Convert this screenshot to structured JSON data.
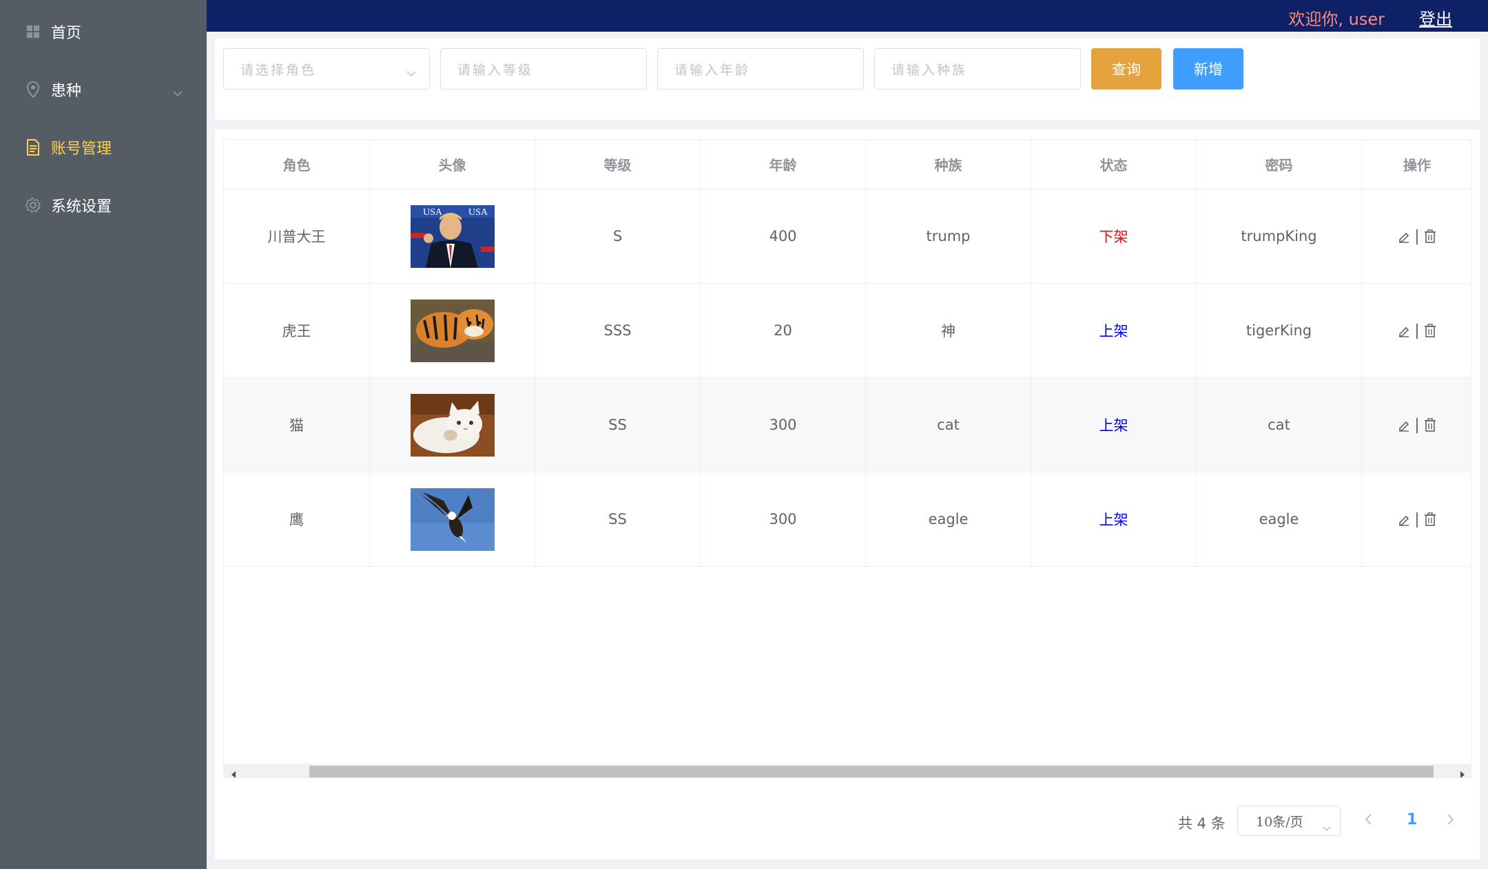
{
  "sidebar": {
    "items": [
      {
        "label": "首页",
        "icon": "grid-icon"
      },
      {
        "label": "患种",
        "icon": "location-icon"
      },
      {
        "label": "账号管理",
        "icon": "document-icon",
        "active": true
      },
      {
        "label": "系统设置",
        "icon": "gear-icon"
      }
    ]
  },
  "header": {
    "welcome": "欢迎你,  user",
    "logout": "登出"
  },
  "filters": {
    "role_placeholder": "请选择角色",
    "level_placeholder": "请输入等级",
    "age_placeholder": "请输入年龄",
    "race_placeholder": "请输入种族",
    "query_label": "查询",
    "add_label": "新增"
  },
  "table": {
    "columns": [
      "角色",
      "头像",
      "等级",
      "年龄",
      "种族",
      "状态",
      "密码",
      "操作"
    ],
    "rows": [
      {
        "role": "川普大王",
        "avatar": "trump-photo",
        "level": "S",
        "age": "400",
        "race": "trump",
        "status": "下架",
        "password": "trumpKing"
      },
      {
        "role": "虎王",
        "avatar": "tiger-photo",
        "level": "SSS",
        "age": "20",
        "race": "神",
        "status": "上架",
        "password": "tigerKing"
      },
      {
        "role": "猫",
        "avatar": "cat-photo",
        "level": "SS",
        "age": "300",
        "race": "cat",
        "status": "上架",
        "password": "cat"
      },
      {
        "role": "鹰",
        "avatar": "eagle-photo",
        "level": "SS",
        "age": "300",
        "race": "eagle",
        "status": "上架",
        "password": "eagle"
      }
    ],
    "op_separator": "|"
  },
  "pagination": {
    "total": "共 4 条",
    "page_size": "10条/页",
    "current_page": "1"
  },
  "colors": {
    "sidebar_bg": "#545c64",
    "header_bg": "#0e2166",
    "active_menu": "#ffd04b",
    "query_btn": "#e6a23c",
    "add_btn": "#409eff",
    "status_off": "#ff0000",
    "status_on": "#0000ff"
  }
}
